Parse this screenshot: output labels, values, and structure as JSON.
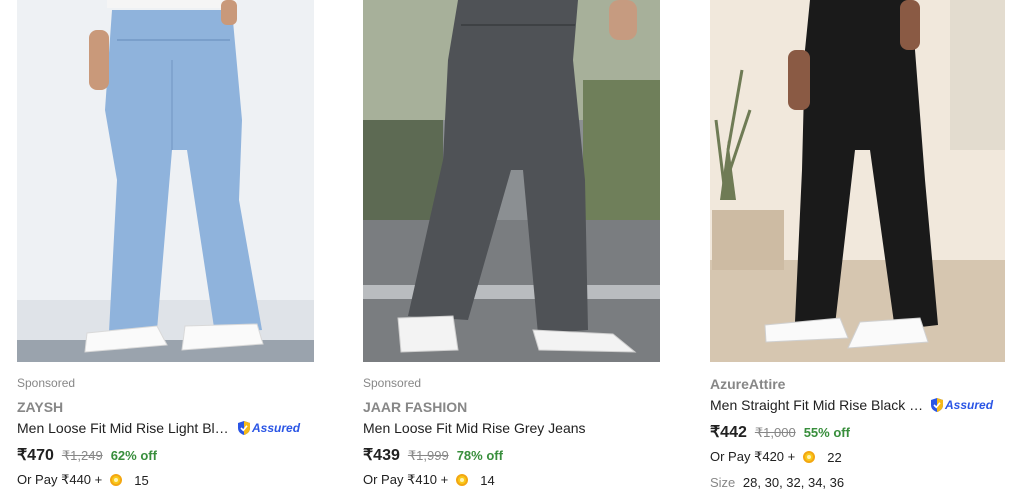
{
  "products": [
    {
      "sponsored": "Sponsored",
      "brand": "ZAYSH",
      "title": "Men Loose Fit Mid Rise Light Blue Jeans",
      "assured": "Assured",
      "price": "₹470",
      "mrp": "₹1,249",
      "discount": "62% off",
      "pay_text": "Or Pay ₹440 +",
      "coins": "15",
      "image": "light-blue-jeans-photo"
    },
    {
      "sponsored": "Sponsored",
      "brand": "JAAR FASHION",
      "title": "Men Loose Fit Mid Rise Grey Jeans",
      "price": "₹439",
      "mrp": "₹1,999",
      "discount": "78% off",
      "pay_text": "Or Pay ₹410 +",
      "coins": "14",
      "image": "grey-jeans-photo"
    },
    {
      "brand": "AzureAttire",
      "title": "Men Straight Fit Mid Rise Black Jeans",
      "assured": "Assured",
      "price": "₹442",
      "mrp": "₹1,000",
      "discount": "55% off",
      "pay_text": "Or Pay ₹420 +",
      "coins": "22",
      "size_label": "Size",
      "sizes": "28, 30, 32, 34, 36",
      "image": "black-jeans-photo"
    }
  ],
  "colors": {
    "discount": "#388e3c",
    "assured": "#2a55e5",
    "coin": "#f9c81a",
    "muted": "#878787"
  }
}
